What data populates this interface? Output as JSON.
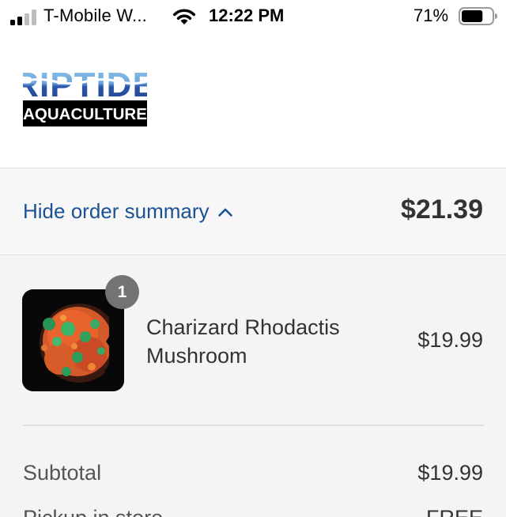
{
  "status_bar": {
    "carrier": "T-Mobile W...",
    "time": "12:22 PM",
    "battery_percent": "71%",
    "battery_level": 0.71,
    "icons": [
      "signal-icon",
      "wifi-icon",
      "battery-icon"
    ]
  },
  "header": {
    "logo": {
      "top_text": "RIPTIDE",
      "bottom_text": "AQUACULTURE"
    }
  },
  "order_summary": {
    "toggle_label": "Hide order summary",
    "toggle_icon": "chevron-up-icon",
    "total": "$21.39",
    "link_color": "#1a5293"
  },
  "line_items": [
    {
      "quantity": "1",
      "name": "Charizard Rhodactis Mushroom",
      "price": "$19.99"
    }
  ],
  "totals": {
    "subtotal_label": "Subtotal",
    "subtotal_value": "$19.99",
    "shipping_label": "Pickup in store",
    "shipping_value": "FREE"
  }
}
